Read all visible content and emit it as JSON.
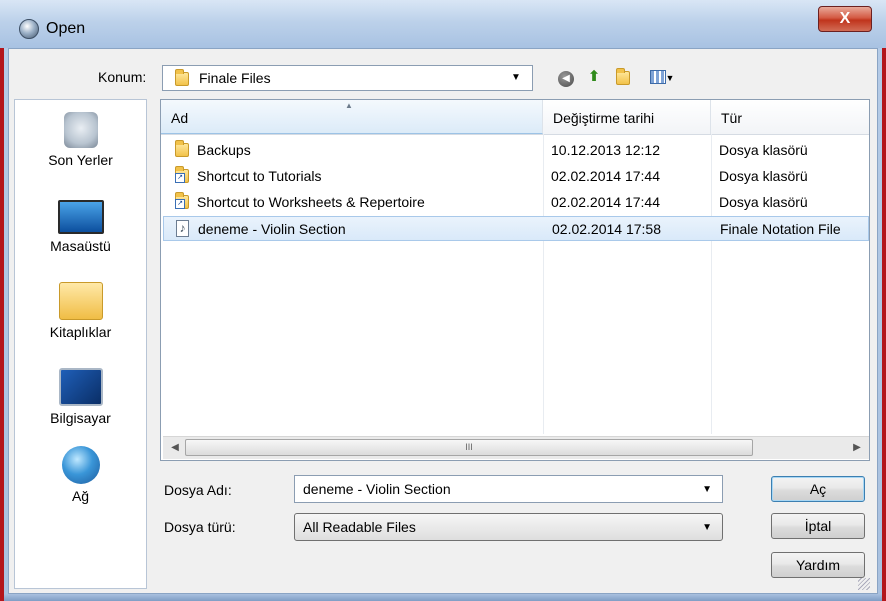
{
  "window": {
    "title": "Open",
    "close_label": "X"
  },
  "location": {
    "label": "Konum:",
    "value": "Finale Files"
  },
  "toolbar": {
    "back_icon": "back-arrow-icon",
    "up_icon": "up-folder-icon",
    "new_folder_icon": "new-folder-icon",
    "view_icon": "view-menu-icon"
  },
  "places": [
    {
      "label": "Son Yerler",
      "icon": "recent-places-icon"
    },
    {
      "label": "Masaüstü",
      "icon": "desktop-icon"
    },
    {
      "label": "Kitaplıklar",
      "icon": "libraries-icon"
    },
    {
      "label": "Bilgisayar",
      "icon": "computer-icon"
    },
    {
      "label": "Ağ",
      "icon": "network-icon"
    }
  ],
  "columns": {
    "name": "Ad",
    "date": "Değiştirme tarihi",
    "type": "Tür"
  },
  "files": [
    {
      "name": "Backups",
      "date": "10.12.2013 12:12",
      "type": "Dosya klasörü",
      "icon": "folder-icon"
    },
    {
      "name": "Shortcut to Tutorials",
      "date": "02.02.2014 17:44",
      "type": "Dosya klasörü",
      "icon": "shortcut-folder-icon"
    },
    {
      "name": "Shortcut to Worksheets & Repertoire",
      "date": "02.02.2014 17:44",
      "type": "Dosya klasörü",
      "icon": "shortcut-folder-icon"
    },
    {
      "name": "deneme - Violin Section",
      "date": "02.02.2014 17:58",
      "type": "Finale Notation File",
      "icon": "music-file-icon",
      "selected": true
    }
  ],
  "filename": {
    "label": "Dosya Adı:",
    "value": "deneme - Violin Section"
  },
  "filetype": {
    "label": "Dosya türü:",
    "value": "All Readable Files"
  },
  "buttons": {
    "open": "Aç",
    "cancel": "İptal",
    "help": "Yardım"
  }
}
